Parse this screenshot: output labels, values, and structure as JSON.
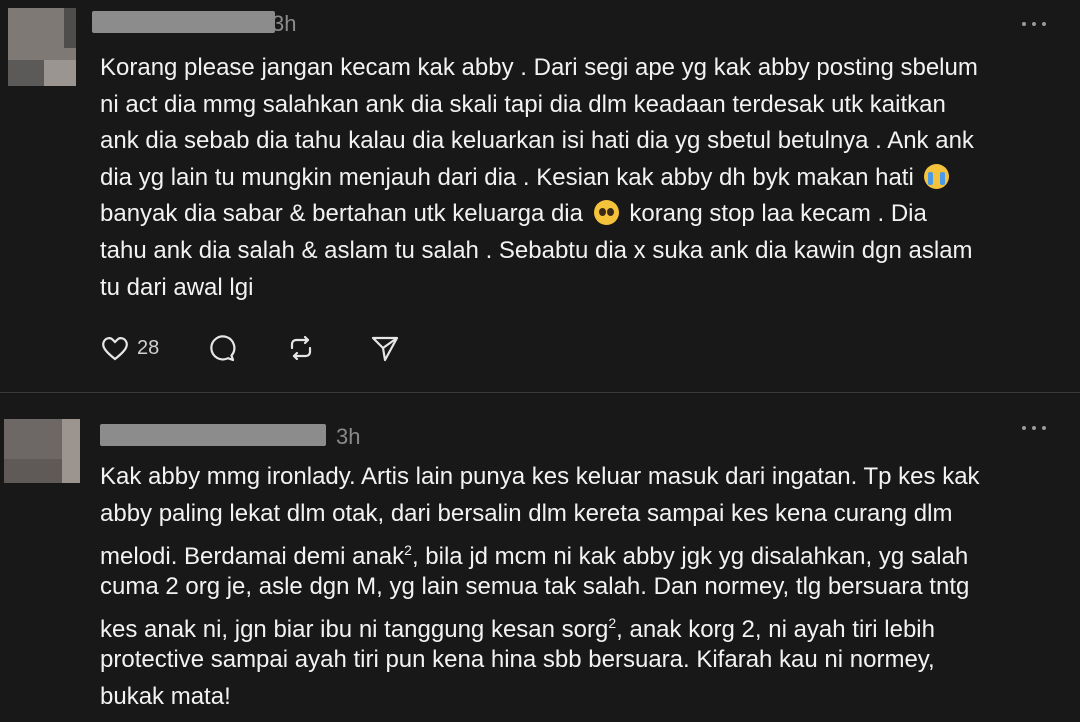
{
  "posts": [
    {
      "timestamp": "3h",
      "lines": [
        "Korang please jangan kecam kak abby . Dari segi ape yg kak abby posting sbelum",
        "ni act dia mmg salahkan ank dia skali tapi dia dlm keadaan terdesak utk kaitkan",
        "ank dia sebab dia tahu kalau dia keluarkan isi hati dia yg sbetul betulnya . Ank ank",
        "dia yg lain tu mungkin menjauh dari dia . Kesian kak abby dh byk makan hati",
        "banyak dia sabar & bertahan utk keluarga dia",
        "korang stop laa kecam . Dia",
        "tahu ank dia salah & aslam tu salah . Sebabtu dia x suka ank dia kawin dgn aslam",
        "tu dari awal lgi"
      ],
      "emojis": [
        "loudly-crying-face-icon",
        "pleading-face-icon"
      ],
      "likes": "28"
    },
    {
      "timestamp": "3h",
      "lines": [
        "Kak abby mmg ironlady. Artis lain punya kes keluar masuk dari ingatan. Tp kes kak",
        "abby paling lekat dlm otak, dari bersalin dlm kereta sampai kes kena curang dlm",
        "melodi. Berdamai demi anak",
        ", bila jd mcm ni kak abby jgk yg disalahkan, yg salah",
        "cuma 2 org je, asle dgn M, yg lain semua tak salah. Dan normey, tlg bersuara tntg",
        "kes anak ni, jgn biar ibu ni tanggung kesan sorg",
        ", anak korg 2, ni ayah tiri lebih",
        "protective sampai ayah tiri pun kena hina sbb bersuara. Kifarah kau ni normey,",
        "bukak mata!"
      ],
      "superscripts": [
        "2",
        "2"
      ]
    }
  ],
  "colors": {
    "background": "#181818",
    "text": "#f2f2f2",
    "muted": "#8a8a8a",
    "divider": "#3a3a3a"
  },
  "icons": [
    "heart-icon",
    "comment-icon",
    "repost-icon",
    "share-icon",
    "more-icon"
  ]
}
